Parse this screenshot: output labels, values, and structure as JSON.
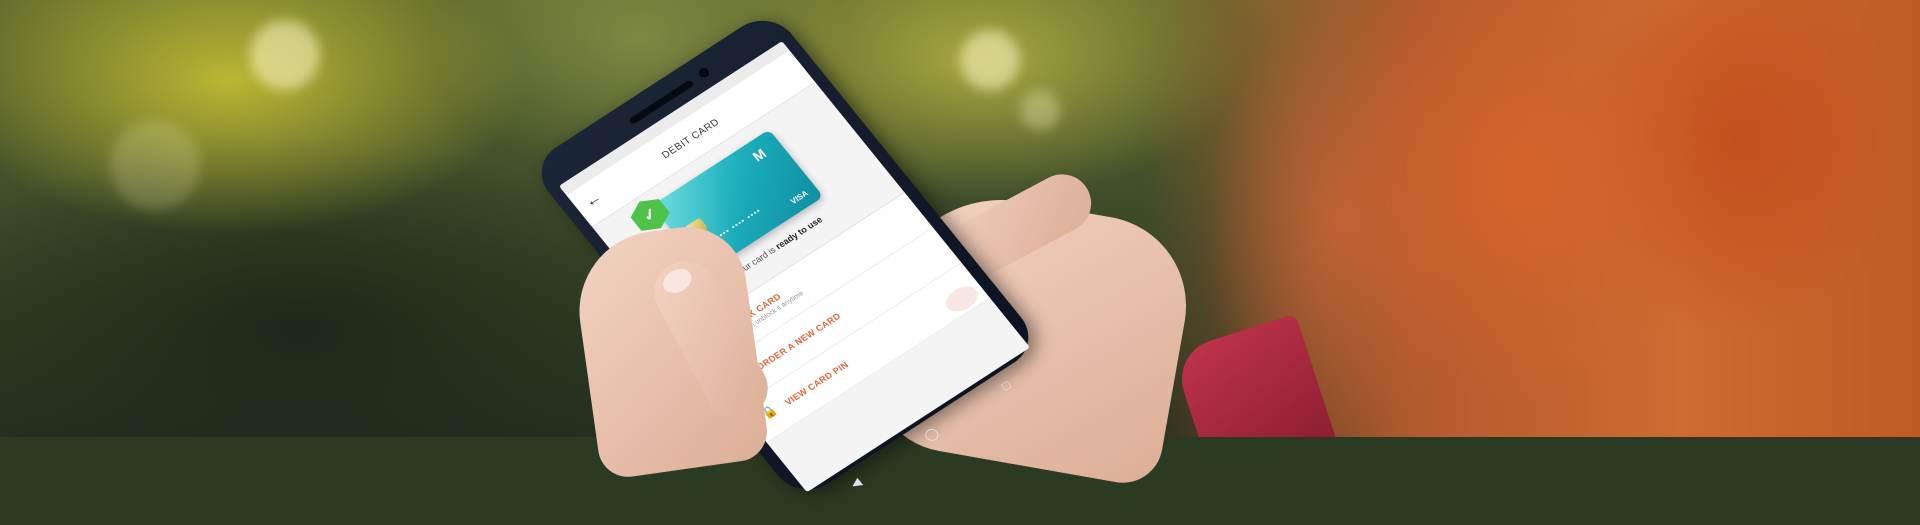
{
  "app": {
    "title": "DEBIT CARD",
    "status": {
      "text_before": "Your card is",
      "text_strong": "ready to use"
    },
    "card": {
      "brand_icon": "bank-logo-icon",
      "network": "VISA",
      "number_mask": "•••• •••• •••• ••••",
      "color": "#1aa9b8"
    },
    "badge_icon": "check-icon",
    "menu": [
      {
        "label": "BLOCK CARD",
        "sub": "You can unblock it anytime",
        "icon": "block-icon"
      },
      {
        "label": "ORDER A NEW CARD",
        "sub": "",
        "icon": "card-icon"
      },
      {
        "label": "VIEW CARD PIN",
        "sub": "",
        "icon": "lock-icon"
      }
    ],
    "accent_color": "#e2643a"
  }
}
